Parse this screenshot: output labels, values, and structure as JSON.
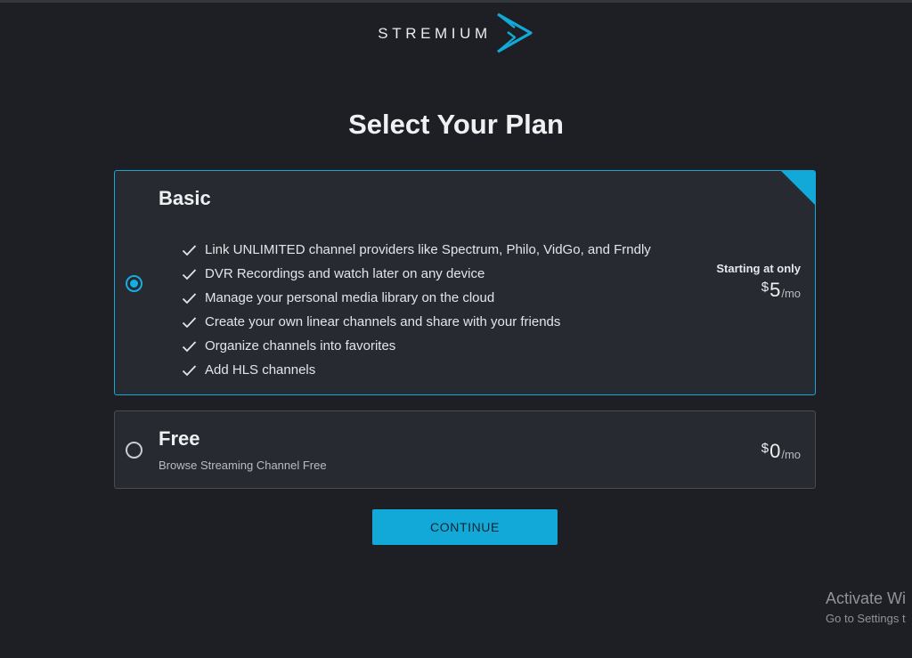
{
  "brand": {
    "name": "STREMIUM",
    "accent_color": "#12a8d8"
  },
  "page": {
    "title": "Select Your Plan"
  },
  "plans": [
    {
      "name": "Basic",
      "selected": true,
      "features": [
        "Link UNLIMITED channel providers like Spectrum, Philo, VidGo, and Frndly",
        "DVR Recordings and watch later on any device",
        "Manage your personal media library on the cloud",
        "Create your own linear channels and share with your friends",
        "Organize channels into favorites",
        "Add HLS channels"
      ],
      "price_caption": "Starting at only",
      "price_currency": "$",
      "price_amount": "5",
      "price_period": "/mo"
    },
    {
      "name": "Free",
      "selected": false,
      "description": "Browse Streaming Channel Free",
      "price_currency": "$",
      "price_amount": "0",
      "price_period": "/mo"
    }
  ],
  "actions": {
    "continue_label": "CONTINUE"
  },
  "watermark": {
    "title": "Activate Wi",
    "subtitle": "Go to Settings t"
  }
}
